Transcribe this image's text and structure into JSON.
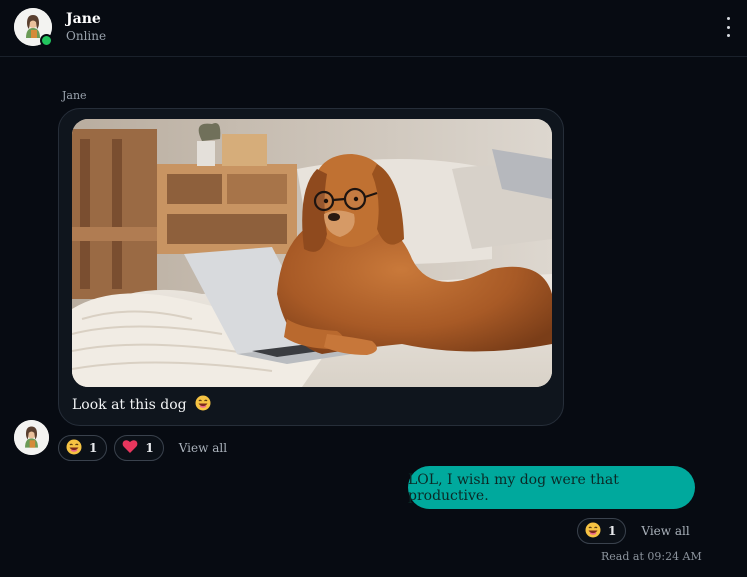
{
  "header": {
    "name": "Jane",
    "status": "Online",
    "menu_icon": "more-vertical-icon"
  },
  "messages": {
    "incoming": {
      "sender": "Jane",
      "image_alt": "Golden retriever wearing glasses using a laptop on a bed",
      "caption": "Look at this dog",
      "caption_emoji": "laughing-face-icon",
      "reactions": [
        {
          "icon": "laughing-face-icon",
          "count": "1"
        },
        {
          "icon": "heart-icon",
          "count": "1"
        }
      ],
      "view_all": "View all"
    },
    "outgoing": {
      "text": "LOL, I wish my dog were that productive.",
      "reactions": [
        {
          "icon": "laughing-face-icon",
          "count": "1"
        }
      ],
      "view_all": "View all",
      "read_status": "Read at 09:24 AM"
    }
  },
  "colors": {
    "background": "#070b12",
    "incoming_bubble": "#0f151d",
    "outgoing_bubble": "#00a99d",
    "online": "#22c55e"
  }
}
